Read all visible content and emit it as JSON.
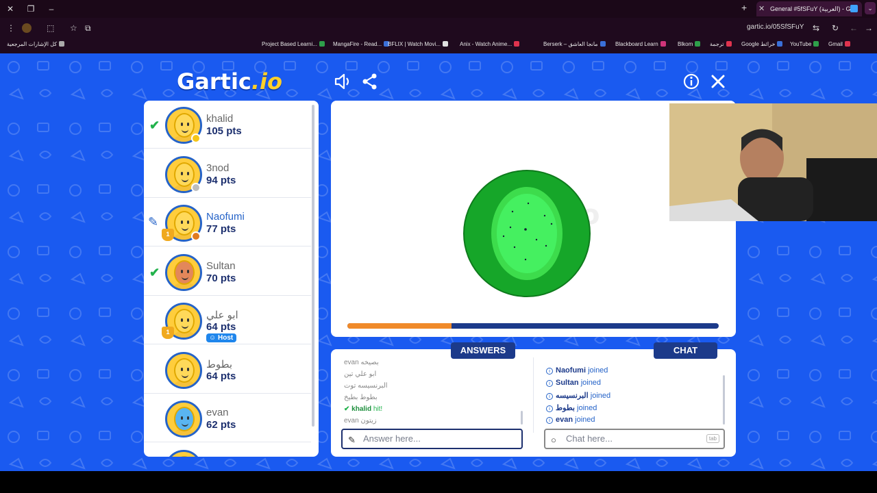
{
  "browser": {
    "tab_title": "General #5fSFuY (العربية) - G",
    "url": "gartic.io/05SfSFuY",
    "bookmarks": [
      {
        "label": "كل الإشارات المرجعية",
        "color": "#aaaaaa"
      },
      {
        "label": "Project Based Learni...",
        "color": "#2e9e4a"
      },
      {
        "label": "MangaFire - Read...",
        "color": "#3a6fd8"
      },
      {
        "label": "BFLIX | Watch Movi...",
        "color": "#e0e0e0"
      },
      {
        "label": "Anix - Watch Anime...",
        "color": "#e0334e"
      },
      {
        "label": "Berserk – مانجا العاشق",
        "color": "#3a6fd8"
      },
      {
        "label": "Blackboard Learn",
        "color": "#d0347a"
      },
      {
        "label": "Blkom",
        "color": "#2e9e4a"
      },
      {
        "label": "ترجمة",
        "color": "#e0334e"
      },
      {
        "label": "Google خرائط",
        "color": "#3a6fd8"
      },
      {
        "label": "YouTube",
        "color": "#2e9e4a"
      },
      {
        "label": "Gmail",
        "color": "#e0334e"
      }
    ]
  },
  "game": {
    "logo_main": "Gartic",
    "logo_suffix": ".io",
    "players": [
      {
        "name": "khalid",
        "points": "105 pts",
        "guessed": true,
        "dot": "#f5c518",
        "face": "#ffd95a"
      },
      {
        "name": "3nod",
        "points": "94 pts",
        "guessed": false,
        "dot": "#bdbdbd",
        "face": "#ffd95a"
      },
      {
        "name": "Naofumi",
        "points": "77 pts",
        "guessed": false,
        "drawing": true,
        "trophy": "1",
        "dot": "#e07b20",
        "face": "#ffd95a",
        "name_color": "#2563c8"
      },
      {
        "name": "Sultan",
        "points": "70 pts",
        "guessed": true,
        "face": "#e3875a"
      },
      {
        "name": "ابو علي",
        "points": "64 pts",
        "guessed": false,
        "trophy": "1",
        "host_label": "Host",
        "face": "#ffd95a"
      },
      {
        "name": "بطوط",
        "points": "64 pts",
        "guessed": false,
        "face": "#ffd95a"
      },
      {
        "name": "evan",
        "points": "62 pts",
        "guessed": false,
        "face": "#5ab5f0"
      }
    ],
    "timer_fraction": 0.28,
    "answers_title": "ANSWERS",
    "chat_title": "CHAT",
    "answers": [
      {
        "user": "evan",
        "text": "بصيخه"
      },
      {
        "user": "ابو علي",
        "text": "تين"
      },
      {
        "user": "البرنسيسه",
        "text": "توت"
      },
      {
        "user": "بطوط",
        "text": "بطيخ"
      },
      {
        "user": "khalid",
        "text": "hit!",
        "hit": true
      },
      {
        "user": "evan",
        "text": "زيتون"
      }
    ],
    "chat": [
      {
        "user": "Naofumi",
        "text": "joined"
      },
      {
        "user": "Sultan",
        "text": "joined"
      },
      {
        "user": "البرنسيسه",
        "text": "joined"
      },
      {
        "user": "بطوط",
        "text": "joined"
      },
      {
        "user": "evan",
        "text": "joined"
      }
    ],
    "answer_placeholder": "Answer here...",
    "chat_placeholder": "Chat here...",
    "tab_hint": "tab"
  }
}
